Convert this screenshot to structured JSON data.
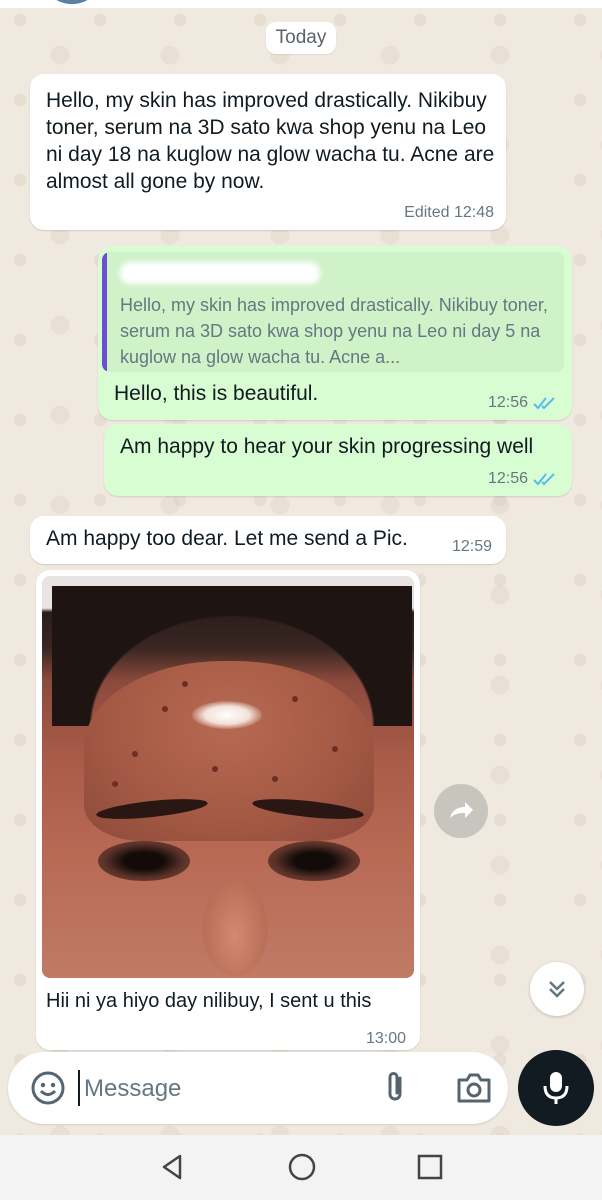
{
  "chat": {
    "date_label": "Today",
    "messages": [
      {
        "text": "Hello, my skin has improved drastically. Nikibuy toner, serum na 3D sato kwa shop yenu na Leo ni day 18 na kuglow na glow wacha tu. Acne are almost all gone by now.",
        "meta": "Edited 12:48"
      },
      {
        "quote_text": "Hello, my skin has improved drastically. Nikibuy toner, serum na 3D sato kwa shop yenu na Leo ni day 5 na kuglow na glow  wacha tu. Acne a...",
        "text": "Hello, this is beautiful.",
        "time": "12:56"
      },
      {
        "text": "Am happy to hear your skin progressing well",
        "time": "12:56"
      },
      {
        "text": "Am happy too dear. Let me send a Pic.",
        "time": "12:59"
      },
      {
        "caption": "Hii ni ya hiyo day nilibuy, I sent u this",
        "time": "13:00"
      }
    ]
  },
  "composer": {
    "placeholder": "Message"
  },
  "colors": {
    "outgoing_bubble": "#d9fdd3",
    "incoming_bubble": "#ffffff",
    "read_ticks": "#53bdeb",
    "quote_bar": "#6a4fd3",
    "mic_button": "#111b21"
  },
  "icons": {
    "forward": "forward-icon",
    "scroll_down": "double-chevron-down-icon",
    "emoji": "emoji-icon",
    "attach": "paperclip-icon",
    "camera": "camera-icon",
    "mic": "microphone-icon",
    "nav_back": "back-triangle-icon",
    "nav_home": "home-circle-icon",
    "nav_recent": "recent-apps-icon"
  }
}
